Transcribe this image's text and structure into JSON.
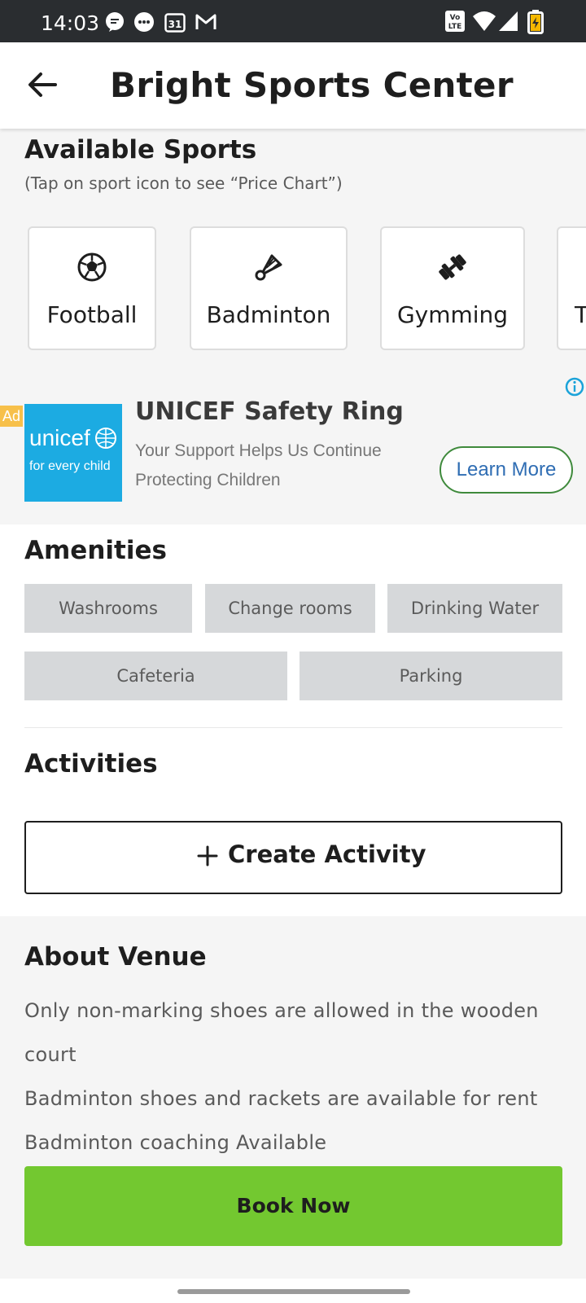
{
  "status_bar": {
    "time": "14:03",
    "icons": [
      "message-icon",
      "chat-bubble-icon",
      "calendar-icon",
      "gmail-icon",
      "volte-icon",
      "wifi-icon",
      "signal-icon",
      "battery-icon"
    ],
    "calendar_day": "31"
  },
  "header": {
    "title": "Bright Sports Center",
    "back_icon": "arrow-left-icon"
  },
  "sports": {
    "heading": "Available Sports",
    "note": "(Tap on sport icon to see “Price Chart”)",
    "items": [
      {
        "label": "Football",
        "icon": "soccer-ball-icon"
      },
      {
        "label": "Badminton",
        "icon": "shuttlecock-icon"
      },
      {
        "label": "Gymming",
        "icon": "dumbbell-icon"
      },
      {
        "label": "T",
        "icon": ""
      }
    ]
  },
  "ad": {
    "badge": "Ad",
    "logo_text": "unicef",
    "logo_subtext": "for every child",
    "title": "UNICEF Safety Ring",
    "description": "Your Support Helps Us Continue Protecting Children",
    "cta": "Learn More",
    "info_icon": "info-icon"
  },
  "amenities": {
    "heading": "Amenities",
    "items": [
      "Washrooms",
      "Change rooms",
      "Drinking Water",
      "Cafeteria",
      "Parking"
    ]
  },
  "activities": {
    "heading": "Activities",
    "create_label": "Create Activity"
  },
  "about": {
    "heading": "About Venue",
    "lines": [
      "Only non-marking shoes are allowed in the wooden",
      "court",
      "Badminton shoes and rackets are available for rent",
      "Badminton coaching Available"
    ]
  },
  "book_now": "Book Now",
  "colors": {
    "status_bar": "#2a2d30",
    "book_button": "#73c830",
    "chip_bg": "#d6d8da",
    "unicef_blue": "#1cabe2",
    "cta_border": "#3f8a3c",
    "cta_text": "#2f6db3"
  }
}
